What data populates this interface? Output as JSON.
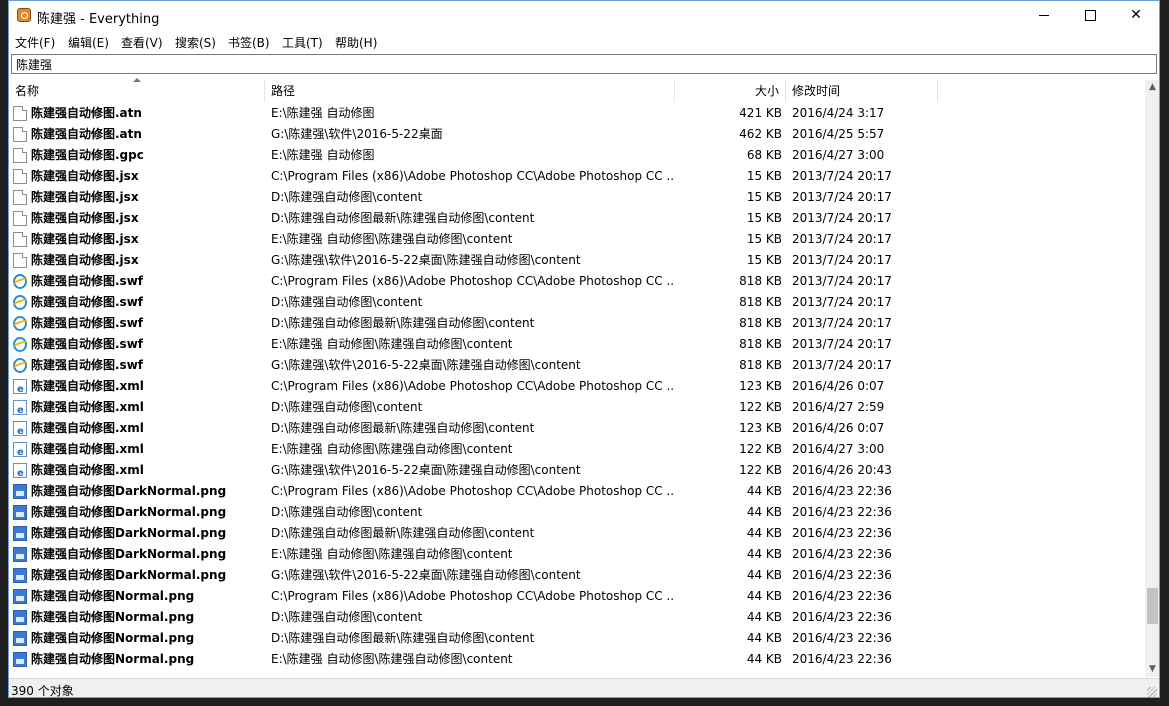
{
  "window": {
    "title": "陈建强 - Everything"
  },
  "menu": [
    "文件(F)",
    "编辑(E)",
    "查看(V)",
    "搜索(S)",
    "书签(B)",
    "工具(T)",
    "帮助(H)"
  ],
  "search": {
    "value": "陈建强"
  },
  "columns": {
    "name": "名称",
    "path": "路径",
    "size": "大小",
    "date": "修改时间"
  },
  "rows": [
    {
      "icon": "doc-icon",
      "name": "陈建强自动修图.atn",
      "path": "E:\\陈建强 自动修图",
      "size": "421 KB",
      "date": "2016/4/24 3:17"
    },
    {
      "icon": "doc-icon",
      "name": "陈建强自动修图.atn",
      "path": "G:\\陈建强\\软件\\2016-5-22桌面",
      "size": "462 KB",
      "date": "2016/4/25 5:57"
    },
    {
      "icon": "doc-icon",
      "name": "陈建强自动修图.gpc",
      "path": "E:\\陈建强 自动修图",
      "size": "68 KB",
      "date": "2016/4/27 3:00"
    },
    {
      "icon": "doc-icon",
      "name": "陈建强自动修图.jsx",
      "path": "C:\\Program Files (x86)\\Adobe Photoshop CC\\Adobe Photoshop CC ...",
      "size": "15 KB",
      "date": "2013/7/24 20:17"
    },
    {
      "icon": "doc-icon",
      "name": "陈建强自动修图.jsx",
      "path": "D:\\陈建强自动修图\\content",
      "size": "15 KB",
      "date": "2013/7/24 20:17"
    },
    {
      "icon": "doc-icon",
      "name": "陈建强自动修图.jsx",
      "path": "D:\\陈建强自动修图最新\\陈建强自动修图\\content",
      "size": "15 KB",
      "date": "2013/7/24 20:17"
    },
    {
      "icon": "doc-icon",
      "name": "陈建强自动修图.jsx",
      "path": "E:\\陈建强 自动修图\\陈建强自动修图\\content",
      "size": "15 KB",
      "date": "2013/7/24 20:17"
    },
    {
      "icon": "doc-icon",
      "name": "陈建强自动修图.jsx",
      "path": "G:\\陈建强\\软件\\2016-5-22桌面\\陈建强自动修图\\content",
      "size": "15 KB",
      "date": "2013/7/24 20:17"
    },
    {
      "icon": "ie-icon",
      "name": "陈建强自动修图.swf",
      "path": "C:\\Program Files (x86)\\Adobe Photoshop CC\\Adobe Photoshop CC ...",
      "size": "818 KB",
      "date": "2013/7/24 20:17"
    },
    {
      "icon": "ie-icon",
      "name": "陈建强自动修图.swf",
      "path": "D:\\陈建强自动修图\\content",
      "size": "818 KB",
      "date": "2013/7/24 20:17"
    },
    {
      "icon": "ie-icon",
      "name": "陈建强自动修图.swf",
      "path": "D:\\陈建强自动修图最新\\陈建强自动修图\\content",
      "size": "818 KB",
      "date": "2013/7/24 20:17"
    },
    {
      "icon": "ie-icon",
      "name": "陈建强自动修图.swf",
      "path": "E:\\陈建强 自动修图\\陈建强自动修图\\content",
      "size": "818 KB",
      "date": "2013/7/24 20:17"
    },
    {
      "icon": "ie-icon",
      "name": "陈建强自动修图.swf",
      "path": "G:\\陈建强\\软件\\2016-5-22桌面\\陈建强自动修图\\content",
      "size": "818 KB",
      "date": "2013/7/24 20:17"
    },
    {
      "icon": "xml-icon",
      "name": "陈建强自动修图.xml",
      "path": "C:\\Program Files (x86)\\Adobe Photoshop CC\\Adobe Photoshop CC ...",
      "size": "123 KB",
      "date": "2016/4/26 0:07"
    },
    {
      "icon": "xml-icon",
      "name": "陈建强自动修图.xml",
      "path": "D:\\陈建强自动修图\\content",
      "size": "122 KB",
      "date": "2016/4/27 2:59"
    },
    {
      "icon": "xml-icon",
      "name": "陈建强自动修图.xml",
      "path": "D:\\陈建强自动修图最新\\陈建强自动修图\\content",
      "size": "123 KB",
      "date": "2016/4/26 0:07"
    },
    {
      "icon": "xml-icon",
      "name": "陈建强自动修图.xml",
      "path": "E:\\陈建强 自动修图\\陈建强自动修图\\content",
      "size": "122 KB",
      "date": "2016/4/27 3:00"
    },
    {
      "icon": "xml-icon",
      "name": "陈建强自动修图.xml",
      "path": "G:\\陈建强\\软件\\2016-5-22桌面\\陈建强自动修图\\content",
      "size": "122 KB",
      "date": "2016/4/26 20:43"
    },
    {
      "icon": "png-icon",
      "name": "陈建强自动修图DarkNormal.png",
      "path": "C:\\Program Files (x86)\\Adobe Photoshop CC\\Adobe Photoshop CC ...",
      "size": "44 KB",
      "date": "2016/4/23 22:36"
    },
    {
      "icon": "png-icon",
      "name": "陈建强自动修图DarkNormal.png",
      "path": "D:\\陈建强自动修图\\content",
      "size": "44 KB",
      "date": "2016/4/23 22:36"
    },
    {
      "icon": "png-icon",
      "name": "陈建强自动修图DarkNormal.png",
      "path": "D:\\陈建强自动修图最新\\陈建强自动修图\\content",
      "size": "44 KB",
      "date": "2016/4/23 22:36"
    },
    {
      "icon": "png-icon",
      "name": "陈建强自动修图DarkNormal.png",
      "path": "E:\\陈建强 自动修图\\陈建强自动修图\\content",
      "size": "44 KB",
      "date": "2016/4/23 22:36"
    },
    {
      "icon": "png-icon",
      "name": "陈建强自动修图DarkNormal.png",
      "path": "G:\\陈建强\\软件\\2016-5-22桌面\\陈建强自动修图\\content",
      "size": "44 KB",
      "date": "2016/4/23 22:36"
    },
    {
      "icon": "png-icon",
      "name": "陈建强自动修图Normal.png",
      "path": "C:\\Program Files (x86)\\Adobe Photoshop CC\\Adobe Photoshop CC ...",
      "size": "44 KB",
      "date": "2016/4/23 22:36"
    },
    {
      "icon": "png-icon",
      "name": "陈建强自动修图Normal.png",
      "path": "D:\\陈建强自动修图\\content",
      "size": "44 KB",
      "date": "2016/4/23 22:36"
    },
    {
      "icon": "png-icon",
      "name": "陈建强自动修图Normal.png",
      "path": "D:\\陈建强自动修图最新\\陈建强自动修图\\content",
      "size": "44 KB",
      "date": "2016/4/23 22:36"
    },
    {
      "icon": "png-icon",
      "name": "陈建强自动修图Normal.png",
      "path": "E:\\陈建强 自动修图\\陈建强自动修图\\content",
      "size": "44 KB",
      "date": "2016/4/23 22:36"
    }
  ],
  "status": {
    "text": "390 个对象"
  }
}
